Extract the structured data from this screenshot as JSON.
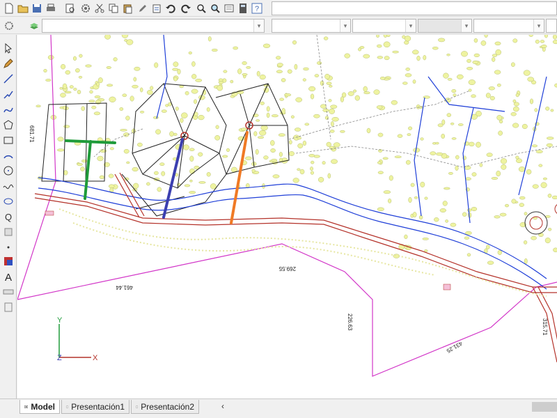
{
  "tabs": [
    {
      "label": "Model",
      "active": true
    },
    {
      "label": "Presentación1",
      "active": false
    },
    {
      "label": "Presentación2",
      "active": false
    }
  ],
  "scroll_left_glyph": "‹",
  "drawing": {
    "dimension_labels": [
      "681.71",
      "461.44",
      "269.55",
      "226.63",
      "431.25",
      "315.71"
    ],
    "road_label": "",
    "axis": {
      "y": "Y",
      "x": "X",
      "z": "Z"
    }
  },
  "colors": {
    "green_marker": "#1f9b3a",
    "blue_marker": "#3b3fb0",
    "orange_marker": "#f07a25",
    "river": "#1f3fd8",
    "road": "#b4322a",
    "boundary": "#d236c8",
    "vegetation": "#eef3a0"
  },
  "toolbar_icons": [
    "new-file-icon",
    "open-folder-icon",
    "save-icon",
    "print-icon",
    "print-preview-icon",
    "gear-icon",
    "scissors-icon",
    "copy-icon",
    "paste-icon",
    "pencil-icon",
    "clipboard-icon",
    "undo-icon",
    "redo-icon",
    "zoom-icon",
    "zoom-window-icon",
    "properties-icon",
    "calculator-icon",
    "help-icon"
  ],
  "left_tools": [
    "pointer-icon",
    "pencil-icon",
    "line-icon",
    "polyline-icon",
    "spline-icon",
    "polygon-icon",
    "rectangle-icon",
    "arc-icon",
    "circle-icon",
    "wave-icon",
    "ellipse-icon",
    "zoom-text-icon",
    "stamp-icon",
    "dot-icon",
    "fill-icon",
    "text-icon",
    "dimension-icon",
    "block-icon"
  ]
}
